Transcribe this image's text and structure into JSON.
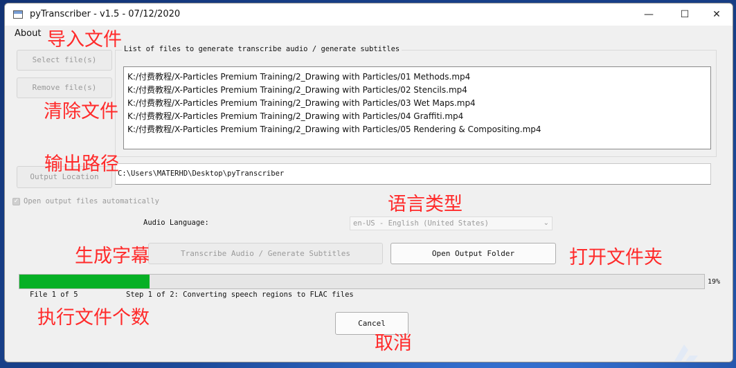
{
  "window": {
    "title": "pyTranscriber - v1.5 - 07/12/2020",
    "minimize": "—",
    "maximize": "☐",
    "close": "✕"
  },
  "menu": {
    "about": "About"
  },
  "buttons": {
    "select_files": "Select file(s)",
    "remove_files": "Remove file(s)",
    "output_location": "Output Location",
    "transcribe": "Transcribe Audio / Generate Subtitles",
    "open_output_folder": "Open Output Folder",
    "cancel": "Cancel"
  },
  "files_group": {
    "label": "List of files to generate transcribe audio / generate subtitles",
    "files": [
      "K:/付费教程/X-Particles Premium Training/2_Drawing with Particles/01 Methods.mp4",
      "K:/付费教程/X-Particles Premium Training/2_Drawing with Particles/02 Stencils.mp4",
      "K:/付费教程/X-Particles Premium Training/2_Drawing with Particles/03 Wet Maps.mp4",
      "K:/付费教程/X-Particles Premium Training/2_Drawing with Particles/04 Graffiti.mp4",
      "K:/付费教程/X-Particles Premium Training/2_Drawing with Particles/05 Rendering & Compositing.mp4"
    ]
  },
  "output": {
    "path": "C:\\Users\\MATERHD\\Desktop\\pyTranscriber"
  },
  "options": {
    "open_automatically_label": "Open output files automatically",
    "open_automatically_checked": true,
    "check_glyph": "✓"
  },
  "language": {
    "label": "Audio Language:",
    "selected": "en-US - English (United States)",
    "chevron": "⌄"
  },
  "progress": {
    "value_percent": 19,
    "label": "19%",
    "file_status": "File 1 of 5",
    "step_status": "Step 1 of 2: Converting speech regions to FLAC files"
  },
  "annotations": {
    "import_files": "导入文件",
    "clear_files": "清除文件",
    "output_path": "输出路径",
    "language_type": "语言类型",
    "generate_subtitles": "生成字幕",
    "open_folder": "打开文件夹",
    "file_count": "执行文件个数",
    "cancel": "取消"
  },
  "colors": {
    "progress_fill": "#06b025",
    "annotation": "#ff2a2a",
    "wallpaper": "#1d4b9b"
  },
  "icons": {
    "app": "app-window-icon",
    "checkbox": "checkmark-icon",
    "dropdown": "chevron-down-icon",
    "corner": "watermark-logo-icon"
  }
}
